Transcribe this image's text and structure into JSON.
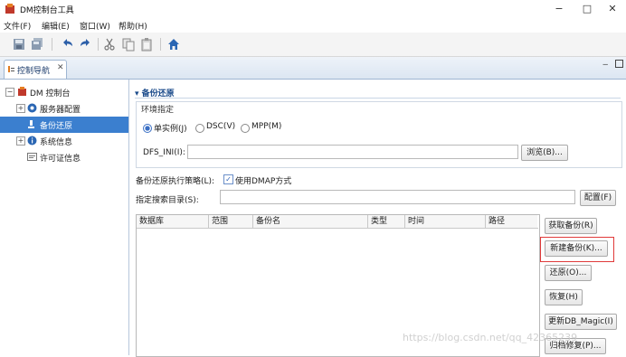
{
  "window": {
    "title": "DM控制台工具",
    "minimize": "−",
    "maximize": "□",
    "close": "✕"
  },
  "menubar": [
    "文件(F)",
    "编辑(E)",
    "窗口(W)",
    "帮助(H)"
  ],
  "toolbar": {
    "icons": [
      "save-icon",
      "save-all-icon",
      "undo-icon",
      "redo-icon",
      "cut-icon",
      "copy-icon",
      "paste-icon",
      "home-icon"
    ]
  },
  "view_tab": {
    "label": "控制导航",
    "close": "✕"
  },
  "tree": {
    "items": [
      {
        "label": "DM 控制台",
        "expander": "−"
      },
      {
        "label": "服务器配置",
        "expander": "+"
      },
      {
        "label": "备份还原",
        "selected": true
      },
      {
        "label": "系统信息",
        "expander": "+"
      },
      {
        "label": "许可证信息"
      }
    ]
  },
  "panel": {
    "title": "备份还原",
    "env_legend": "环境指定",
    "radios": [
      {
        "label": "单实例(J)",
        "checked": true
      },
      {
        "label": "DSC(V)",
        "checked": false
      },
      {
        "label": "MPP(M)",
        "checked": false
      }
    ],
    "dfs_label": "DFS_INI(I):",
    "dfs_value": "",
    "browse_button": "浏览(B)...",
    "strategy_label": "备份还原执行策略(L):",
    "dmap_checkbox": {
      "label": "使用DMAP方式",
      "checked": true
    },
    "search_dir_label": "指定搜索目录(S):",
    "search_dir_value": "",
    "config_button": "配置(F)",
    "table_headers": [
      "数据库",
      "范围",
      "备份名",
      "类型",
      "时间",
      "路径"
    ],
    "side_buttons": [
      "获取备份(R)",
      "新建备份(K)...",
      "还原(O)...",
      "恢复(H)",
      "更新DB_Magic(I)",
      "归档修复(P)..."
    ]
  },
  "watermark": "https://blog.csdn.net/qq_42365239"
}
